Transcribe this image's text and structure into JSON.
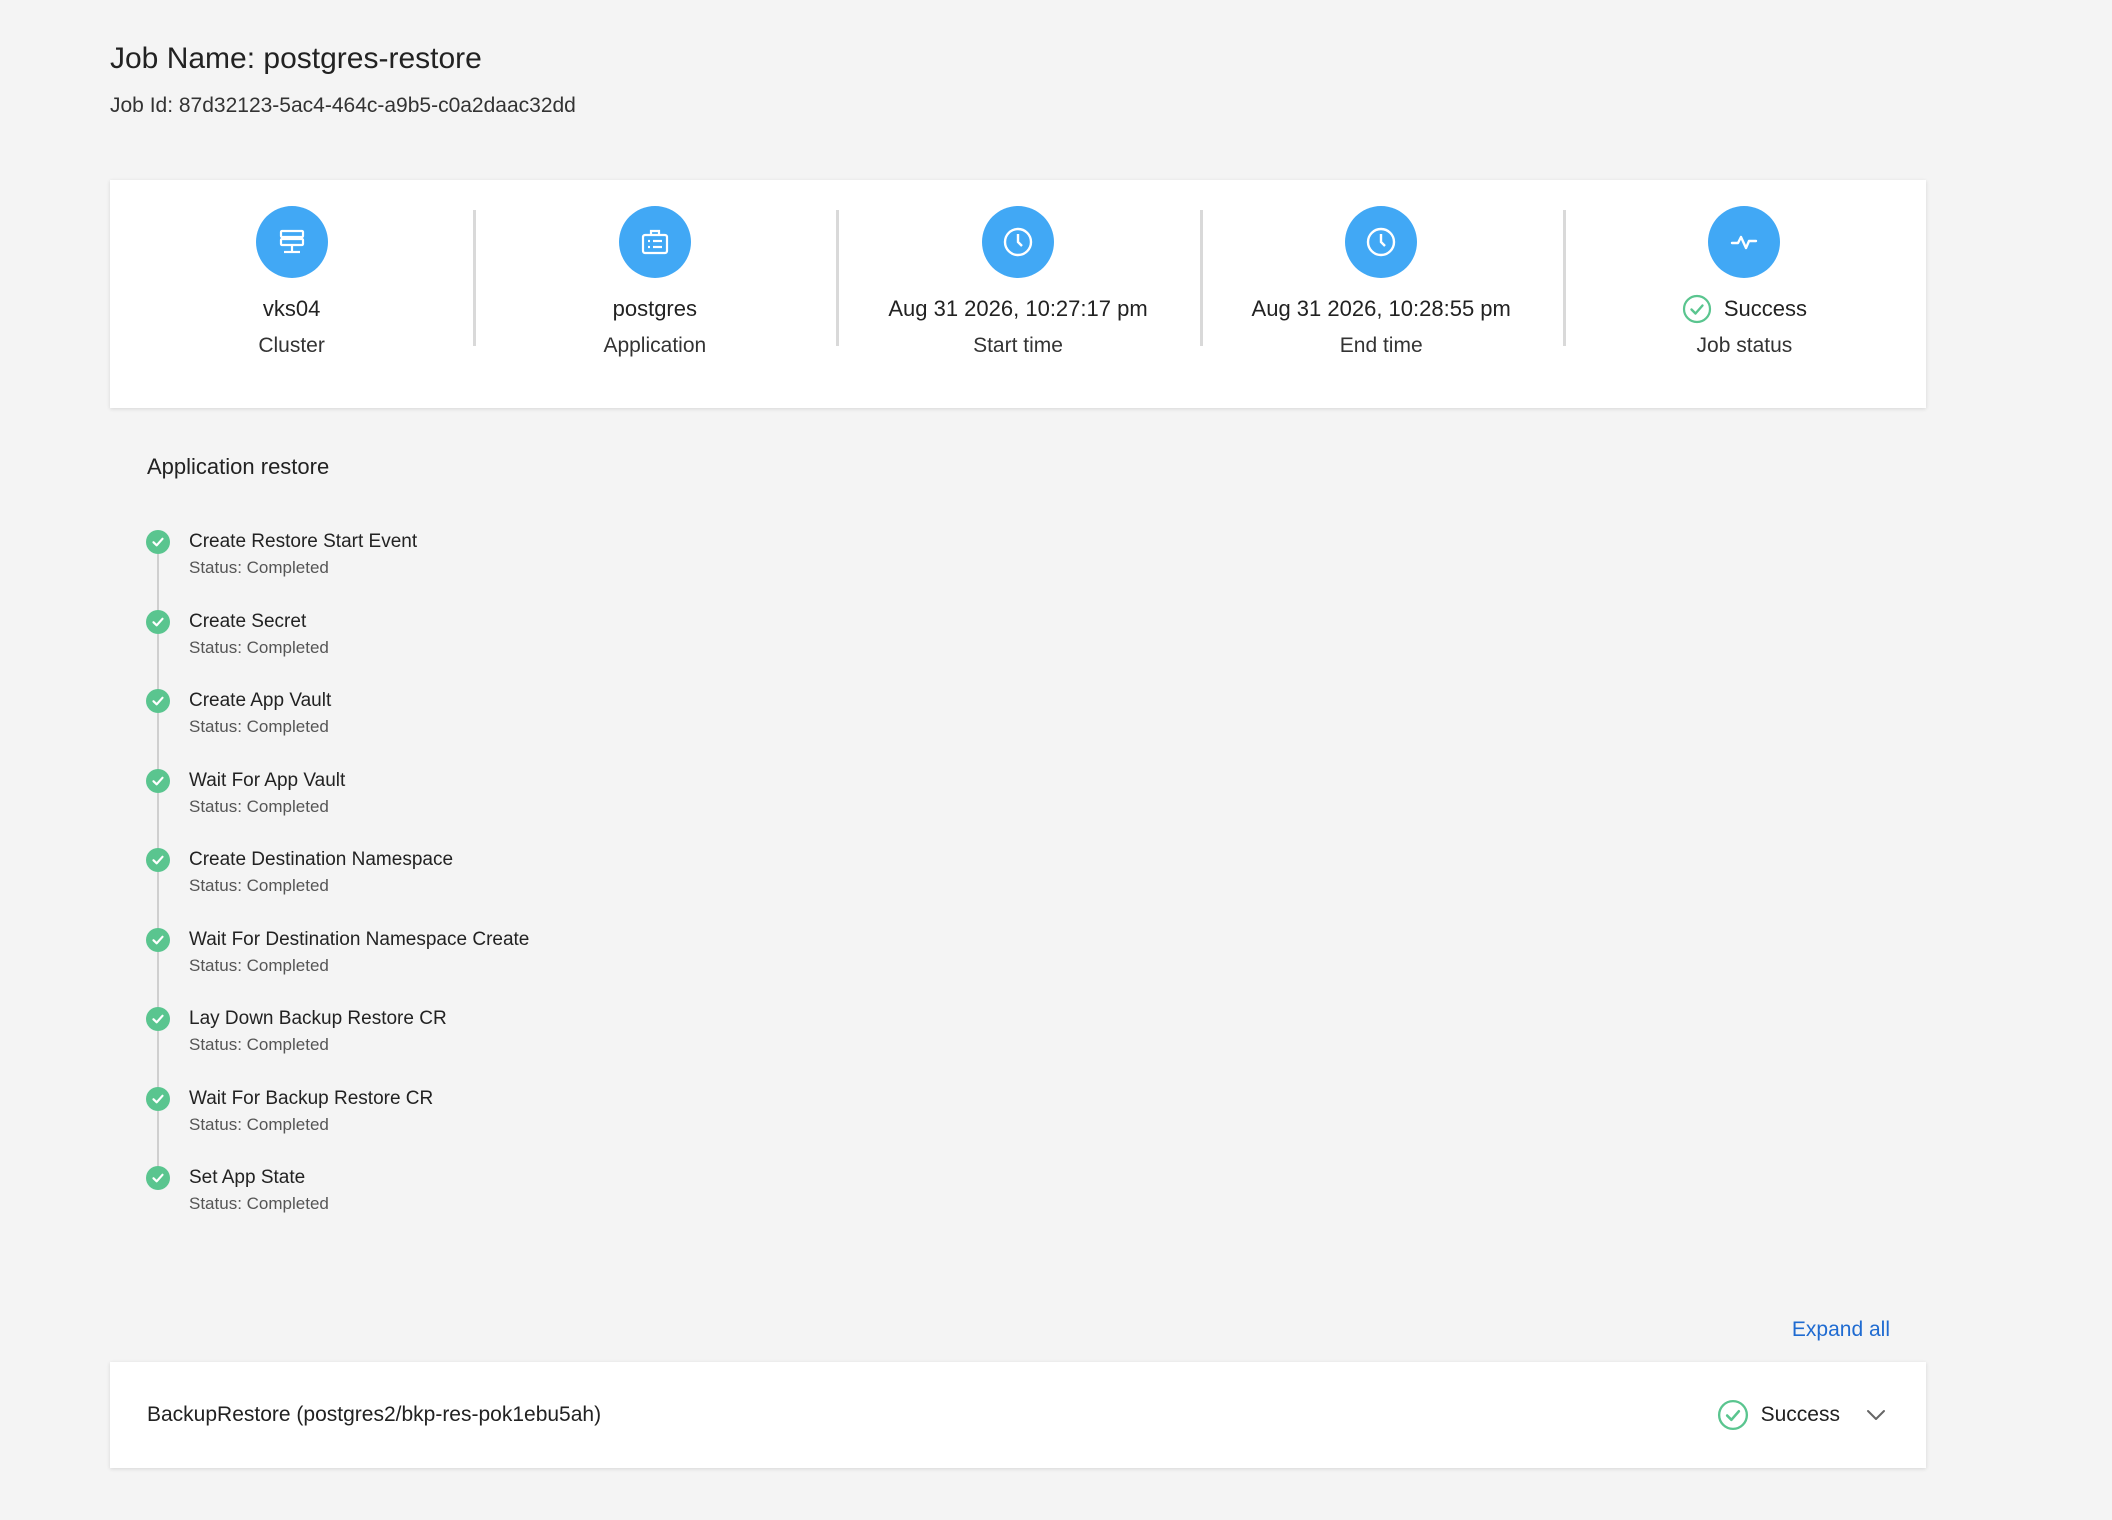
{
  "header": {
    "job_name": "Job Name: postgres-restore",
    "job_id": "Job Id: 87d32123-5ac4-464c-a9b5-c0a2daac32dd"
  },
  "summary": [
    {
      "icon": "server-icon",
      "value": "vks04",
      "label": "Cluster"
    },
    {
      "icon": "briefcase-icon",
      "value": "postgres",
      "label": "Application"
    },
    {
      "icon": "clock-icon",
      "value": "Aug 31 2026, 10:27:17 pm",
      "label": "Start time"
    },
    {
      "icon": "clock-icon",
      "value": "Aug 31 2026, 10:28:55 pm",
      "label": "End time"
    },
    {
      "icon": "activity-icon",
      "value": "Success",
      "label": "Job status"
    }
  ],
  "section_title": "Application restore",
  "steps": [
    {
      "name": "Create Restore Start Event",
      "status": "Status: Completed"
    },
    {
      "name": "Create Secret",
      "status": "Status: Completed"
    },
    {
      "name": "Create App Vault",
      "status": "Status: Completed"
    },
    {
      "name": "Wait For App Vault",
      "status": "Status: Completed"
    },
    {
      "name": "Create Destination Namespace",
      "status": "Status: Completed"
    },
    {
      "name": "Wait For Destination Namespace Create",
      "status": "Status: Completed"
    },
    {
      "name": "Lay Down Backup Restore CR",
      "status": "Status: Completed"
    },
    {
      "name": "Wait For Backup Restore CR",
      "status": "Status: Completed"
    },
    {
      "name": "Set App State",
      "status": "Status: Completed"
    }
  ],
  "expand_all": "Expand all",
  "result": {
    "title": "BackupRestore (postgres2/bkp-res-pok1ebu5ah)",
    "status": "Success"
  },
  "colors": {
    "accent_blue": "#41a8f5",
    "success_green": "#5ac58f",
    "link_blue": "#1f6bd1"
  }
}
